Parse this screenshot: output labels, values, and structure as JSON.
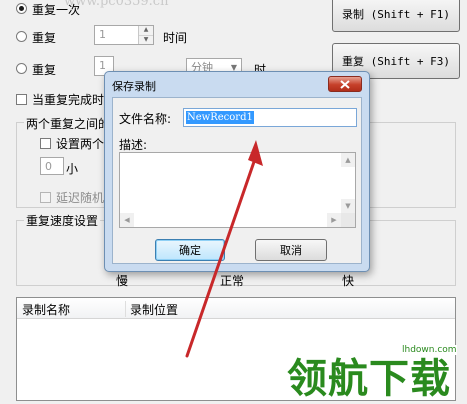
{
  "main": {
    "repeat_once": "重复一次",
    "repeat": "重复",
    "times_value": "1",
    "times_unit": "时间",
    "interval_value": "1",
    "interval_unit_select": "分钟",
    "interval_unit_label": "时",
    "when_done_label": "当重复完成时",
    "between_label": "两个重复之间的",
    "set_between_label": "设置两个",
    "delay_value": "0",
    "delay_unit": "小",
    "random_delay_label": "延迟随机",
    "speed_label": "重复速度设置",
    "speed_slow": "慢",
    "speed_normal": "正常",
    "speed_fast": "快",
    "record_button": "录制 (Shift + F1)",
    "repeat_button": "重复 (Shift + F3)",
    "table_headers": [
      "录制名称",
      "录制位置"
    ],
    "top_cut_text": "www.pc0359.cn"
  },
  "dialog": {
    "title": "保存录制",
    "filename_label": "文件名称:",
    "filename_value": "NewRecord1",
    "desc_label": "描述:",
    "ok_button": "确定",
    "cancel_button": "取消"
  },
  "watermark": {
    "text": "领航下载",
    "url": "lhdown.com"
  },
  "colors": {
    "arrow": "#c8282a",
    "watermark_green": "#2a8a1e",
    "selection": "#3399ff"
  }
}
